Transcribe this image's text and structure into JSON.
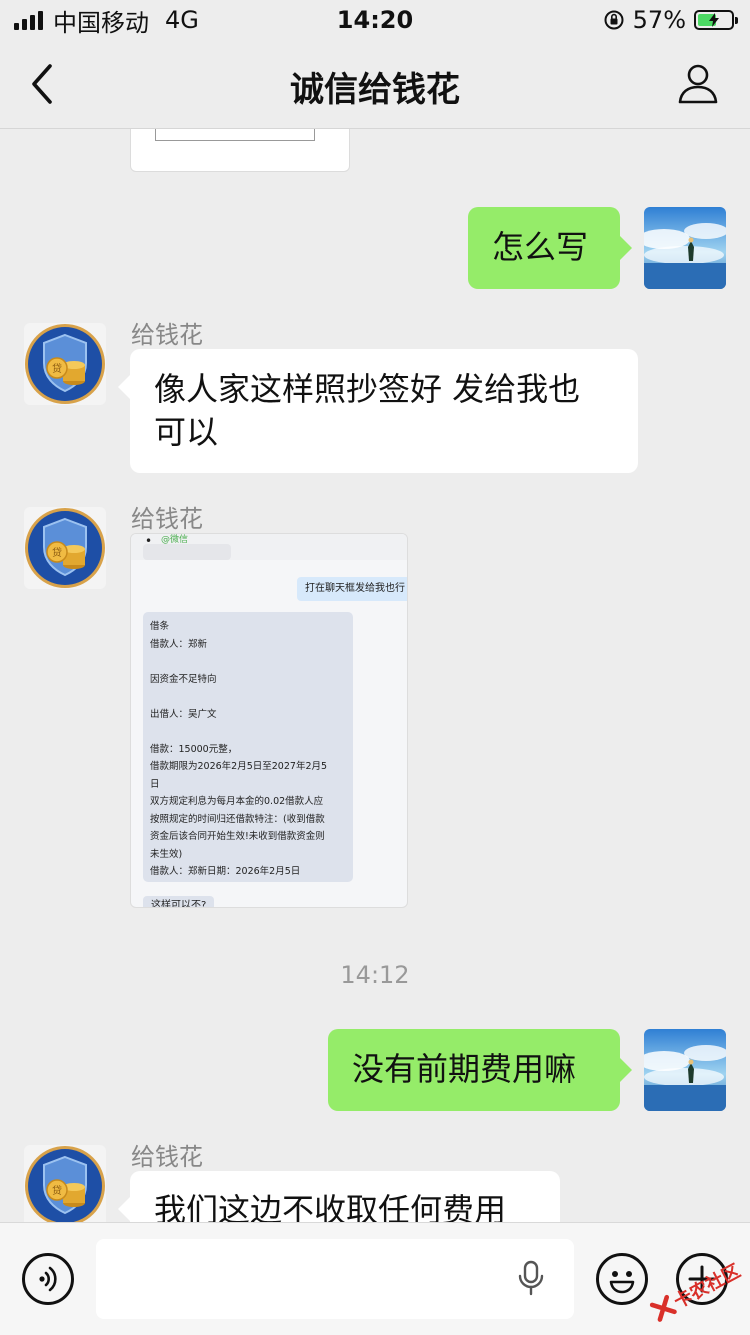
{
  "status_bar": {
    "carrier": "中国移动",
    "network": "4G",
    "time": "14:20",
    "battery": "57%",
    "battery_level": 0.57
  },
  "nav": {
    "title": "诚信给钱花"
  },
  "messages": {
    "msg1": "怎么写",
    "sender": "给钱花",
    "msg2_line1": "像人家这样照抄签好 发给我也",
    "msg2_line2": "可以",
    "timestamp": "14:12",
    "msg3": "没有前期费用嘛",
    "msg4": "我们这边不收取任何费用"
  },
  "image_card": {
    "watermark": "@微信",
    "top_bubble": "打在聊天框发给我也行",
    "lines": [
      "借条",
      "借款人：郑新",
      "",
      "因资金不足特向",
      "",
      "出借人：吴广文",
      "",
      "借款：15000元整，",
      "借款期限为2026年2月5日至2027年2月5",
      "日",
      "双方规定利息为每月本金的0.02借款人应",
      "按照规定的时间归还借款特注：(收到借款",
      "资金后该合同开始生效!未收到借款资金则",
      "未生效)",
      "借款人：郑新日期：2026年2月5日"
    ],
    "bottom_bubble": "这样可以不?"
  },
  "watermark": "卡农社区",
  "colors": {
    "background": "#ededed",
    "sent_bubble": "#95ec69",
    "received_bubble": "#ffffff",
    "avatar_shield": "#1f4fa8",
    "coin": "#e2a82f"
  },
  "icons": [
    "back-icon",
    "user-icon",
    "voice-icon",
    "mic-icon",
    "emoji-icon",
    "plus-icon"
  ]
}
